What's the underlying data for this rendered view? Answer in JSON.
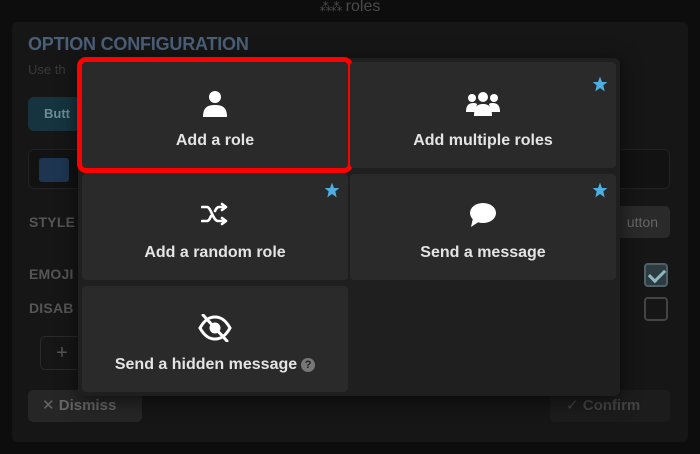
{
  "background": {
    "title": "roles",
    "heading": "OPTION CONFIGURATION",
    "subtitle": "Use th",
    "tab_label": "Butt",
    "style_label": "STYLE",
    "small_button": "utton",
    "emoji_label": "EMOJI",
    "disabled_label": "DISAB",
    "add_symbol": "+",
    "dismiss_label": "Dismiss",
    "confirm_label": "Confirm",
    "emoji_checked": true,
    "disabled_checked": false
  },
  "picker": {
    "options": [
      {
        "label": "Add a role",
        "icon": "user-icon",
        "starred": false,
        "selected": true
      },
      {
        "label": "Add multiple roles",
        "icon": "users-icon",
        "starred": true,
        "selected": false
      },
      {
        "label": "Add a random role",
        "icon": "shuffle-icon",
        "starred": true,
        "selected": false
      },
      {
        "label": "Send a message",
        "icon": "speech-bubble-icon",
        "starred": true,
        "selected": false
      },
      {
        "label": "Send a hidden message",
        "icon": "eye-off-icon",
        "starred": false,
        "selected": false,
        "help": "?"
      }
    ]
  },
  "colors": {
    "star": "#4eb0e0",
    "highlight": "#ff0000"
  }
}
